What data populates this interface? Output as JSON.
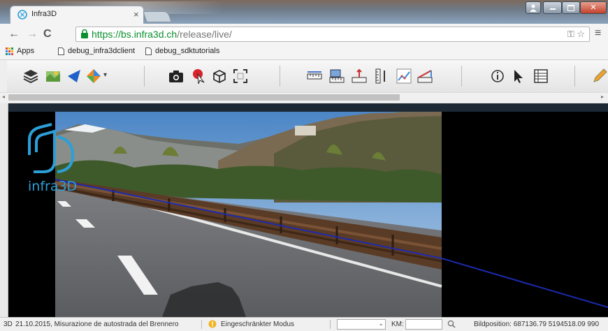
{
  "browser": {
    "tab_title": "Infra3D",
    "tab_close": "×",
    "url_scheme_host": "https://bs.infra3d.ch",
    "url_path": "/release/live/",
    "bookmarks": [
      {
        "label": "Apps",
        "icon": "apps-grid-icon"
      },
      {
        "label": "debug_infra3dclient",
        "icon": "page-icon"
      },
      {
        "label": "debug_sdktutorials",
        "icon": "page-icon"
      }
    ]
  },
  "viewer": {
    "logo_text": "infra3D",
    "scene": "highway-guardrail-mountains"
  },
  "statusbar": {
    "mode_prefix": "3D",
    "recording": "21.10.2015, Misurazione de autostrada del Brennero",
    "restricted_mode": "Eingeschränkter Modus",
    "select_value": "",
    "km_label": "KM:",
    "km_value": "",
    "position_label": "Bildposition: 687136.79 5194518.09 990"
  },
  "colors": {
    "accent": "#2c9fd8",
    "https_green": "#0a8f2e"
  }
}
